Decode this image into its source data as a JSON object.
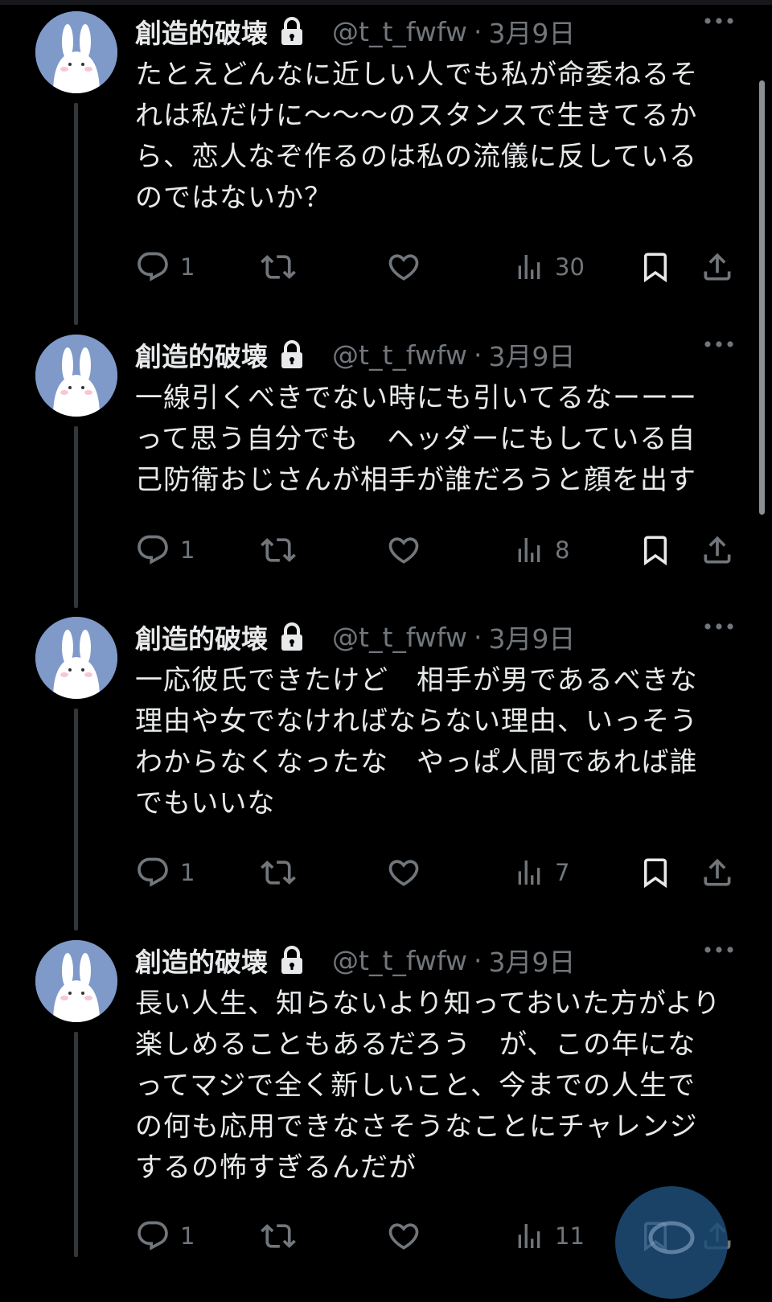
{
  "colors": {
    "background": "#000000",
    "text": "#e7e9ea",
    "muted": "#71767b",
    "thread_line": "#333639",
    "avatar_bg": "#7f9ac9"
  },
  "tweets": [
    {
      "name": "創造的破壊",
      "handle": "@t_t_fwfw",
      "separator": "·",
      "date": "3月9日",
      "text": "たとえどんなに近しい人でも私が命委ねるそれは私だけに〜〜〜のスタンスで生きてるから、恋人なぞ作るのは私の流儀に反しているのではないか？",
      "replies": "1",
      "reposts": "",
      "likes": "",
      "views": "30"
    },
    {
      "name": "創造的破壊",
      "handle": "@t_t_fwfw",
      "separator": "·",
      "date": "3月9日",
      "text": "一線引くべきでない時にも引いてるなーーーって思う自分でも　ヘッダーにもしている自己防衛おじさんが相手が誰だろうと顔を出す",
      "replies": "1",
      "reposts": "",
      "likes": "",
      "views": "8"
    },
    {
      "name": "創造的破壊",
      "handle": "@t_t_fwfw",
      "separator": "·",
      "date": "3月9日",
      "text": "一応彼氏できたけど　相手が男であるべきな理由や女でなければならない理由、いっそうわからなくなったな　やっぱ人間であれば誰でもいいな",
      "replies": "1",
      "reposts": "",
      "likes": "",
      "views": "7"
    },
    {
      "name": "創造的破壊",
      "handle": "@t_t_fwfw",
      "separator": "·",
      "date": "3月9日",
      "text": "長い人生、知らないより知っておいた方がより楽しめることもあるだろう　が、この年になってマジで全く新しいこと、今までの人生での何も応用できなさそうなことにチャレンジするの怖すぎるんだが",
      "replies": "1",
      "reposts": "",
      "likes": "",
      "views": "11"
    }
  ],
  "icons": {
    "lock": "lock-icon",
    "more": "more-icon",
    "reply": "reply-icon",
    "repost": "repost-icon",
    "like": "like-icon",
    "views": "views-icon",
    "bookmark": "bookmark-icon",
    "share": "share-icon",
    "compose": "compose-fab"
  }
}
